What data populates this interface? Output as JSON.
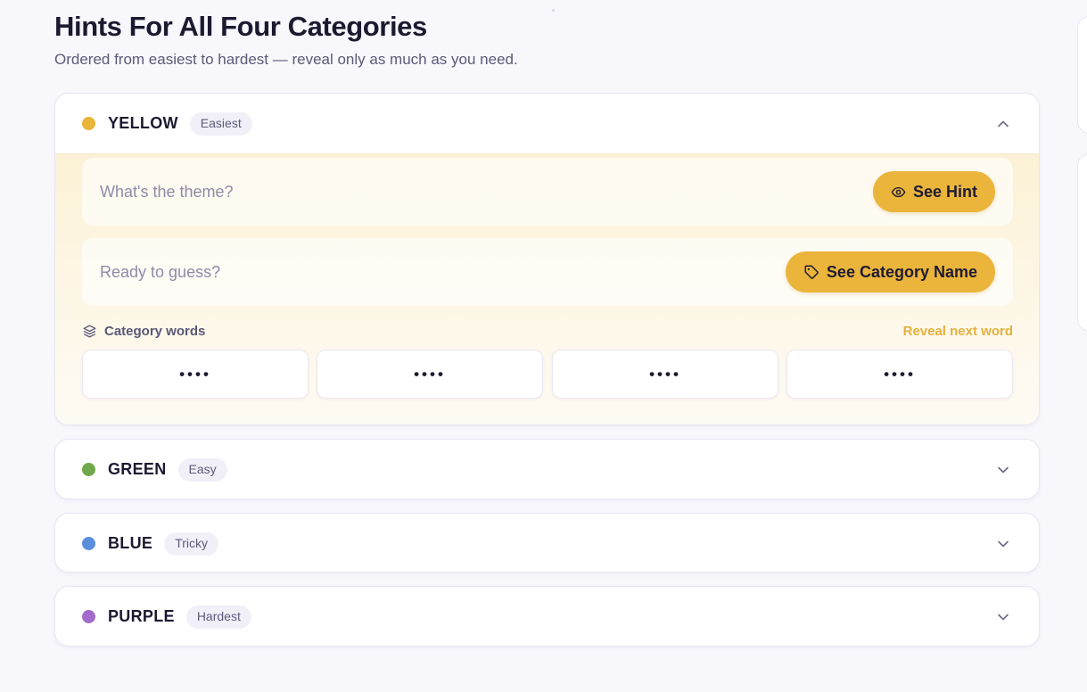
{
  "header": {
    "title": "Hints For All Four Categories",
    "subtitle": "Ordered from easiest to hardest — reveal only as much as you need."
  },
  "categories": [
    {
      "color_name": "YELLOW",
      "difficulty": "Easiest",
      "color": "#e8b43a",
      "expanded": true,
      "theme_prompt": "What's the theme?",
      "hint_button": "See Hint",
      "guess_prompt": "Ready to guess?",
      "category_button": "See Category Name",
      "words_label": "Category words",
      "reveal_next": "Reveal next word",
      "words": [
        "••••",
        "••••",
        "••••",
        "••••"
      ]
    },
    {
      "color_name": "GREEN",
      "difficulty": "Easy",
      "color": "#6fa84a",
      "expanded": false
    },
    {
      "color_name": "BLUE",
      "difficulty": "Tricky",
      "color": "#5a8fdc",
      "expanded": false
    },
    {
      "color_name": "PURPLE",
      "difficulty": "Hardest",
      "color": "#a36ccc",
      "expanded": false
    }
  ],
  "icons": {
    "chevron_up": "chevron-up-icon",
    "chevron_down": "chevron-down-icon",
    "eye": "eye-icon",
    "tag": "tag-icon",
    "layers": "layers-icon"
  },
  "colors": {
    "accent_yellow": "#ebb53b",
    "reveal_link": "#e4b13c",
    "background": "#f7f7fc"
  }
}
